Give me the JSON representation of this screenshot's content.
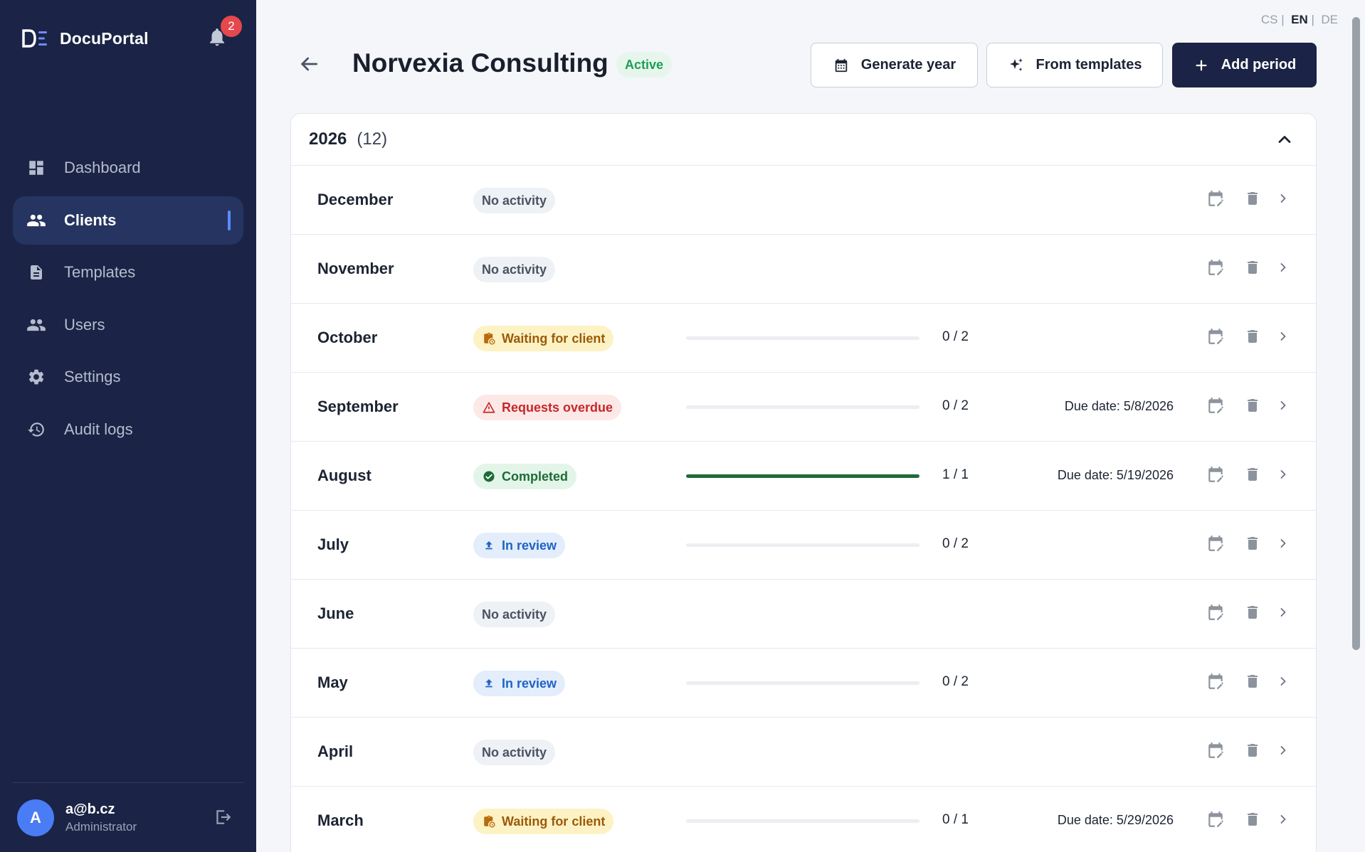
{
  "app": {
    "name": "DocuPortal",
    "notifications": "2"
  },
  "nav": [
    {
      "label": "Dashboard",
      "icon": "dashboard-icon",
      "active": false
    },
    {
      "label": "Clients",
      "icon": "users-icon",
      "active": true
    },
    {
      "label": "Templates",
      "icon": "document-icon",
      "active": false
    },
    {
      "label": "Users",
      "icon": "users-icon",
      "active": false
    },
    {
      "label": "Settings",
      "icon": "gear-icon",
      "active": false
    },
    {
      "label": "Audit logs",
      "icon": "history-icon",
      "active": false
    }
  ],
  "user": {
    "initial": "A",
    "email": "a@b.cz",
    "role": "Administrator"
  },
  "languages": {
    "cs": "CS",
    "en": "EN",
    "de": "DE",
    "sep": "|",
    "current": "EN"
  },
  "client": {
    "name": "Norvexia Consulting",
    "status": "Active"
  },
  "actions": {
    "generate_year": "Generate year",
    "from_templates": "From templates",
    "add_period": "Add period"
  },
  "year_group": {
    "year": "2026",
    "count": "(12)"
  },
  "colors": {
    "sidebar": "#1b2446",
    "accent": "#4a7cf5",
    "progress": "#1e6b3a",
    "active_status": "#1f9d55"
  },
  "periods": [
    {
      "month": "December",
      "status": "No activity",
      "kind": "none",
      "progress": null,
      "due": null
    },
    {
      "month": "November",
      "status": "No activity",
      "kind": "none",
      "progress": null,
      "due": null
    },
    {
      "month": "October",
      "status": "Waiting for client",
      "kind": "wait",
      "progress": "0 / 2",
      "fraction": 0,
      "due": null
    },
    {
      "month": "September",
      "status": "Requests overdue",
      "kind": "overdue",
      "progress": "0 / 2",
      "fraction": 0,
      "due": "Due date: 5/8/2026"
    },
    {
      "month": "August",
      "status": "Completed",
      "kind": "done",
      "progress": "1 / 1",
      "fraction": 1,
      "due": "Due date: 5/19/2026"
    },
    {
      "month": "July",
      "status": "In review",
      "kind": "review",
      "progress": "0 / 2",
      "fraction": 0,
      "due": null
    },
    {
      "month": "June",
      "status": "No activity",
      "kind": "none",
      "progress": null,
      "due": null
    },
    {
      "month": "May",
      "status": "In review",
      "kind": "review",
      "progress": "0 / 2",
      "fraction": 0,
      "due": null
    },
    {
      "month": "April",
      "status": "No activity",
      "kind": "none",
      "progress": null,
      "due": null
    },
    {
      "month": "March",
      "status": "Waiting for client",
      "kind": "wait",
      "progress": "0 / 1",
      "fraction": 0,
      "due": "Due date: 5/29/2026"
    }
  ]
}
